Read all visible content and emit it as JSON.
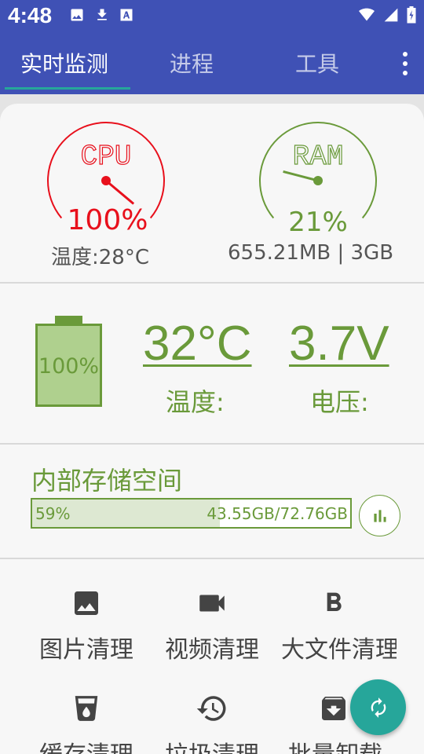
{
  "status_bar": {
    "time": "4:48",
    "left_icons": [
      "image-icon",
      "download-icon",
      "font-icon"
    ],
    "right_icons": [
      "wifi-icon",
      "signal-icon",
      "battery-icon"
    ]
  },
  "tabs": [
    {
      "label": "实时监测",
      "active": true
    },
    {
      "label": "进程",
      "active": false
    },
    {
      "label": "工具",
      "active": false
    }
  ],
  "gauges": {
    "cpu": {
      "name": "CPU",
      "percent_text": "100%",
      "value": 100,
      "color": "#e8101c",
      "subtitle": "温度:28°C"
    },
    "ram": {
      "name": "RAM",
      "percent_text": "21%",
      "value": 21,
      "color": "#6a9a3a",
      "subtitle": "655.21MB | 3GB"
    }
  },
  "battery": {
    "level_text": "100%",
    "level": 1.0,
    "temperature_value": "32°C",
    "temperature_label": "温度:",
    "voltage_value": "3.7V",
    "voltage_label": "电压:"
  },
  "storage": {
    "title": "内部存储空间",
    "percent_text": "59%",
    "used_fraction": 0.59,
    "amount_text": "43.55GB/72.76GB"
  },
  "tools": [
    {
      "label": "图片清理",
      "icon": "image-icon"
    },
    {
      "label": "视频清理",
      "icon": "videocam-icon"
    },
    {
      "label": "大文件清理",
      "icon": "bold-b-icon"
    },
    {
      "label": "缓存清理",
      "icon": "cup-icon"
    },
    {
      "label": "垃圾清理",
      "icon": "history-icon"
    },
    {
      "label": "批量卸载",
      "icon": "archive-icon"
    }
  ],
  "colors": {
    "primary": "#3f51b5",
    "accent": "#26a69a",
    "green": "#6a9a3a",
    "red": "#e8101c"
  }
}
